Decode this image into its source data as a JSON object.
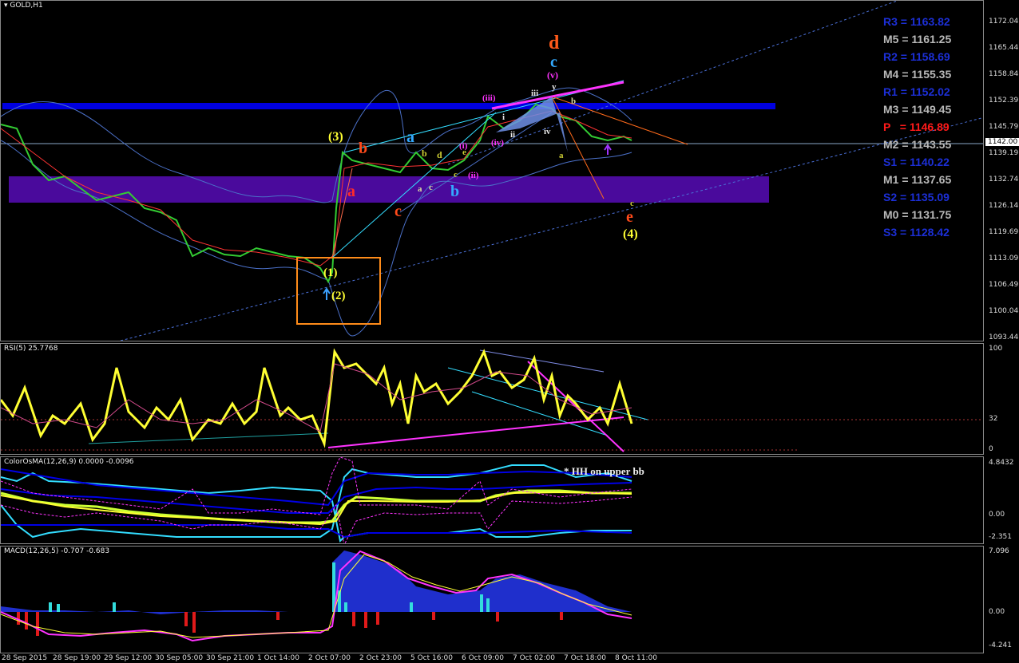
{
  "chart_title": "GOLD,H1",
  "price_axis": [
    "1172.04",
    "1165.44",
    "1158.84",
    "1152.39",
    "1145.79",
    "1139.19",
    "1132.74",
    "1126.14",
    "1119.69",
    "1113.09",
    "1106.49",
    "1100.04",
    "1093.44"
  ],
  "current_price": "1142.00",
  "pivots": [
    {
      "label": "R3 = 1163.82",
      "color": "#1c2fd6"
    },
    {
      "label": "M5 = 1161.25",
      "color": "#b8b8b8"
    },
    {
      "label": "R2 = 1158.69",
      "color": "#1c2fd6"
    },
    {
      "label": "M4 = 1155.35",
      "color": "#b8b8b8"
    },
    {
      "label": "R1 = 1152.02",
      "color": "#1c2fd6"
    },
    {
      "label": "M3 = 1149.45",
      "color": "#b8b8b8"
    },
    {
      "label": "P   = 1146.89",
      "color": "#ff1a1a"
    },
    {
      "label": "M2 = 1143.55",
      "color": "#b8b8b8"
    },
    {
      "label": "S1 = 1140.22",
      "color": "#1c2fd6"
    },
    {
      "label": "M1 = 1137.65",
      "color": "#b8b8b8"
    },
    {
      "label": "S2 = 1135.09",
      "color": "#1c2fd6"
    },
    {
      "label": "M0 = 1131.75",
      "color": "#b8b8b8"
    },
    {
      "label": "S3 = 1128.42",
      "color": "#1c2fd6"
    }
  ],
  "waves": {
    "d": "d",
    "c_top": "c",
    "v": "(v)",
    "y": "y",
    "iii": "(iii)",
    "iii_s": "iii",
    "i": "i",
    "ii": "ii",
    "iv_s": "iv",
    "iv": "(iv)",
    "b_s": "b",
    "a_s": "a",
    "three": "(3)",
    "b_red": "b",
    "a_red": "a",
    "c_red": "c",
    "a_blue": "a",
    "b_blue": "b",
    "b_g": "b",
    "c_g": "c",
    "d_g": "d",
    "e_g": "e",
    "i_p": "(i)",
    "ii_p": "(ii)",
    "a_g2": "a",
    "c_g2": "c",
    "one": "(1)",
    "two": "(2)",
    "c_e": "c",
    "e_red": "e",
    "four": "(4)"
  },
  "rsi": {
    "label": "RSI(5) 25.7768",
    "axis": [
      "100",
      "32",
      "0"
    ]
  },
  "osma": {
    "label": "ColorOsMA(12,26,9) 0.0000 -0.0096",
    "axis": [
      "4.8432",
      "0.00",
      "-2.351"
    ],
    "note": "* HH on upper bb"
  },
  "macd": {
    "label": "MACD(12,26,5) -0.707 -0.683",
    "axis": [
      "7.096",
      "0.00",
      "-4.241"
    ]
  },
  "time_axis": [
    "28 Sep 2015",
    "28 Sep 19:00",
    "29 Sep 12:00",
    "30 Sep 05:00",
    "30 Sep 21:00",
    "1 Oct 14:00",
    "2 Oct 07:00",
    "2 Oct 23:00",
    "5 Oct 16:00",
    "6 Oct 09:00",
    "7 Oct 02:00",
    "7 Oct 18:00",
    "8 Oct 11:00"
  ],
  "colors": {
    "rsi": "#ffff33",
    "upper_band": "#0000e0",
    "purple_band": "#4a0a9c",
    "support": "#3a5bd9",
    "box": "#ff8c1a"
  }
}
